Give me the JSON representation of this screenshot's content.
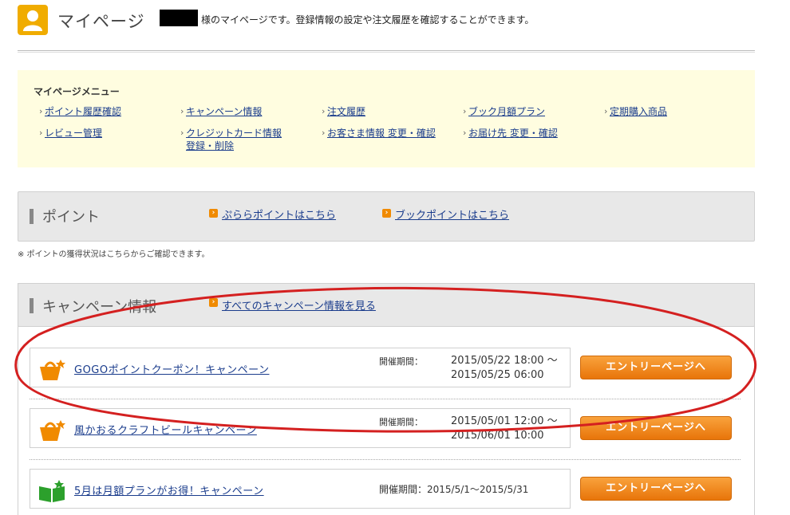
{
  "header": {
    "title": "マイページ",
    "description": "様のマイページです。登録情報の設定や注文履歴を確認することができます。"
  },
  "menu": {
    "title": "マイページメニュー",
    "items": [
      {
        "label": "ポイント履歴確認"
      },
      {
        "label": "キャンペーン情報"
      },
      {
        "label": "注文履歴"
      },
      {
        "label": "ブック月額プラン"
      },
      {
        "label": "定期購入商品"
      },
      {
        "label": "レビュー管理"
      },
      {
        "label": "クレジットカード情報"
      },
      {
        "label": "お客さま情報 変更・確認"
      },
      {
        "label": "お届け先 変更・確認"
      }
    ],
    "credit_line2": "登録・削除"
  },
  "points": {
    "title": "ポイント",
    "links": [
      "ぷららポイントはこちら",
      "ブックポイントはこちら"
    ],
    "note": "※ ポイントの獲得状況はこちらからご確認できます。"
  },
  "campaign": {
    "title": "キャンペーン情報",
    "all_link": "すべてのキャンペーン情報を見る",
    "period_label": "開催期間：",
    "entry_label": "エントリーページへ",
    "items": [
      {
        "name": "GOGOポイントクーポン！キャンペーン",
        "start": "2015/05/22 18:00 〜",
        "end": "2015/05/25 06:00"
      },
      {
        "name": "風かおるクラフトビールキャンペーン",
        "start": "2015/05/01 12:00 〜",
        "end": "2015/06/01 10:00"
      },
      {
        "name": "5月は月額プランがお得！キャンペーン",
        "period": "開催期間：2015/5/1〜2015/5/31"
      }
    ]
  },
  "colors": {
    "accent_orange": "#f08a00",
    "menu_bg": "#fffde0",
    "link": "#1a3c8c",
    "annotation_red": "#d42020"
  }
}
